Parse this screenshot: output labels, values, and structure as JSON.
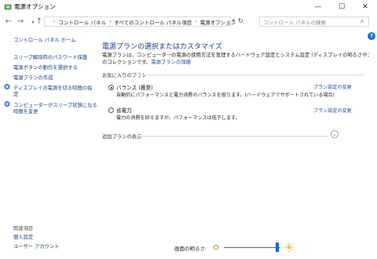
{
  "window": {
    "title": "電源オプション",
    "minimize_glyph": "—",
    "maximize_glyph": "☐",
    "close_glyph": "✕"
  },
  "address": {
    "back_glyph": "←",
    "forward_glyph": "→",
    "up_glyph": "↑",
    "crumbs": [
      "コントロール パネル",
      "すべてのコントロール パネル項目",
      "電源オプション"
    ],
    "crumb_sep": "›",
    "search_placeholder": "コントロール パネルの検索"
  },
  "help_glyph": "?",
  "sidebar": {
    "home": "コントロール パネル ホーム",
    "items": [
      "スリープ解除時のパスワード保護",
      "電源ボタンの動作を選択する",
      "電源プランの作成",
      "ディスプレイの電源を切る時間の指",
      "定",
      "コンピューターがスリープ状態になる",
      "時間を変更"
    ],
    "related_heading": "関連項目",
    "related": [
      "個人設定",
      "ユーザー アカウント"
    ]
  },
  "main": {
    "title": "電源プランの選択またはカスタマイズ",
    "desc_line1": "電源プランは、コンピューターの電源の使用方法を管理するハードウェア設定とシステム設定 (ディスプレイの明るさやスリープなど)",
    "desc_line2": "のコレクションです。",
    "desc_link": "電源プランの詳細",
    "favorites_label": "お気に入りのプラン",
    "plans": [
      {
        "name": "バランス (推奨)",
        "desc": "自動的にパフォーマンスと電力消費のバランスを取ります。(ハードウェアでサポートされている場合)",
        "link": "プラン設定の変更",
        "selected": true
      },
      {
        "name": "省電力",
        "desc": "電力の消費を抑えますが、パフォーマンスは低下します。",
        "link": "プラン設定の変更",
        "selected": false
      }
    ],
    "extra_plans": "追加プランの表示",
    "chevron_glyph": "⌄"
  },
  "brightness": {
    "label": "画面の明るさ:",
    "level_fraction": 0.95
  }
}
